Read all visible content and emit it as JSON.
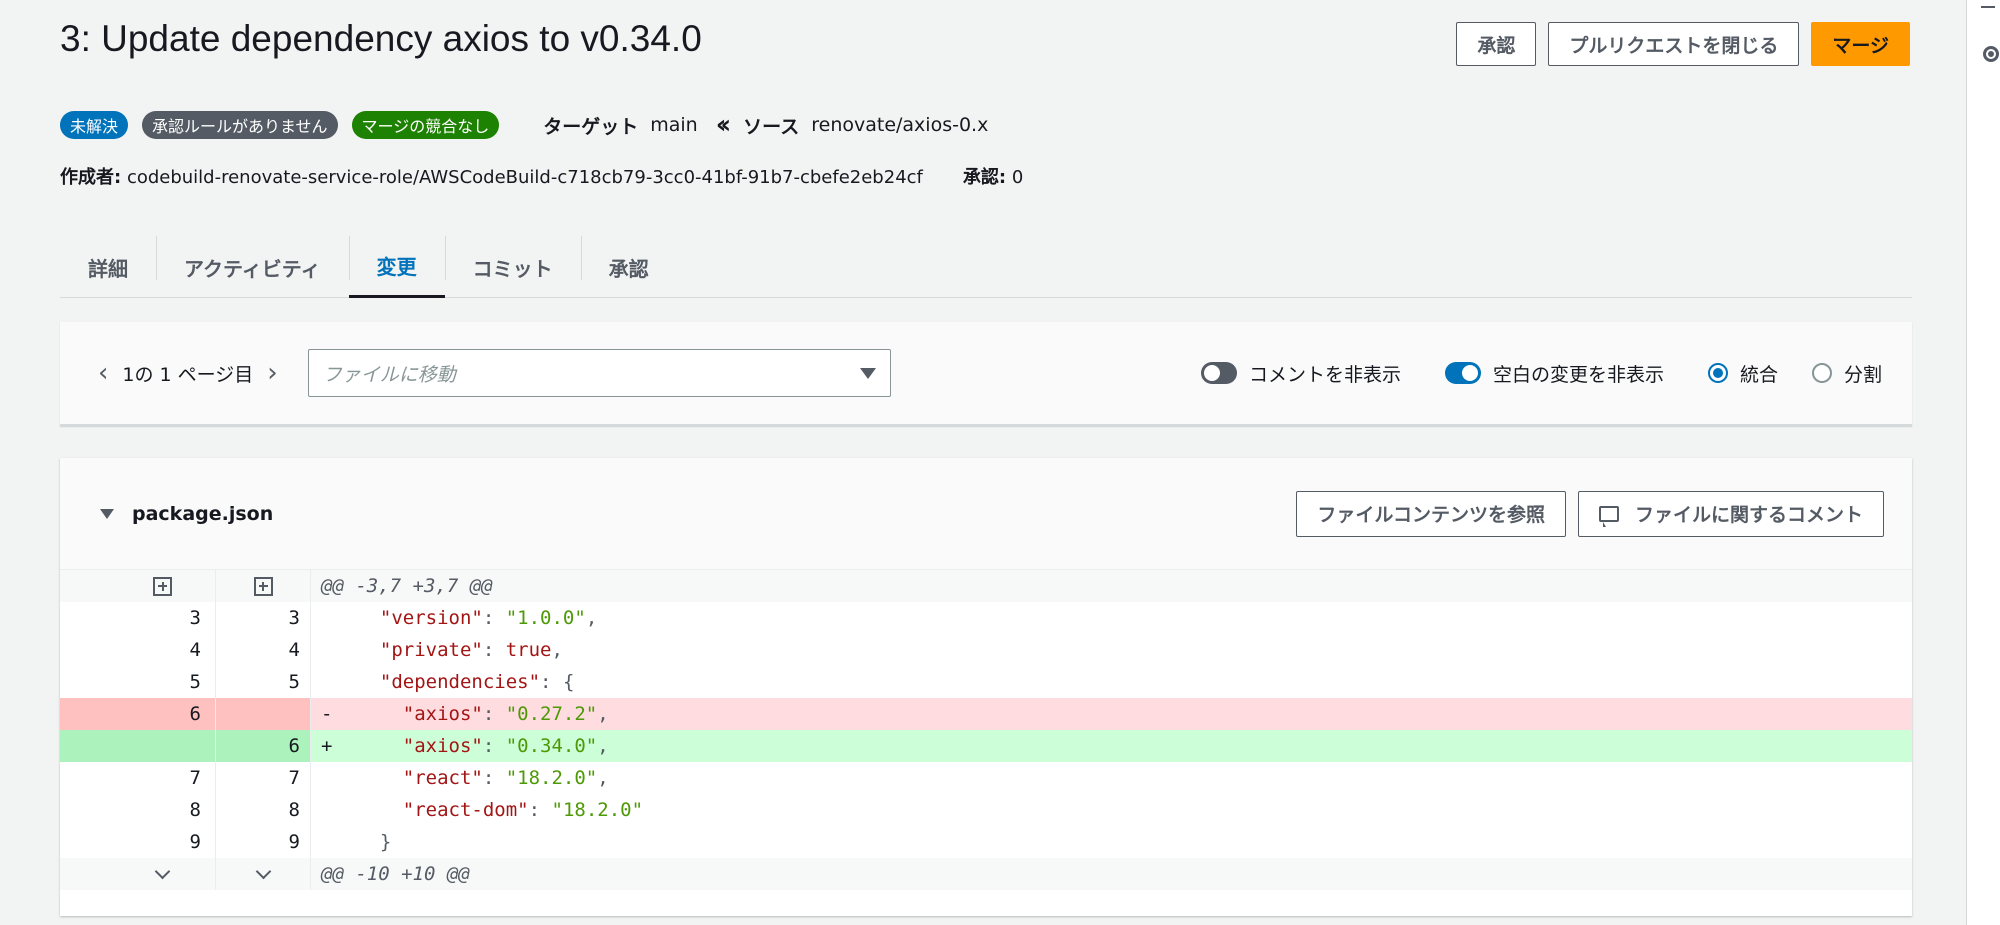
{
  "pr": {
    "title": "3: Update dependency axios to v0.34.0",
    "actions": {
      "approve": "承認",
      "close": "プルリクエストを閉じる",
      "merge": "マージ"
    },
    "badges": {
      "status": "未解決",
      "rules": "承認ルールがありません",
      "conflicts": "マージの競合なし"
    },
    "target_label": "ターゲット",
    "target_branch": "main",
    "source_label": "ソース",
    "source_branch": "renovate/axios-0.x",
    "author_label": "作成者:",
    "author": "codebuild-renovate-service-role/AWSCodeBuild-c718cb79-3cc0-41bf-91b7-cbefe2eb24cf",
    "approvals_label": "承認:",
    "approvals_count": "0"
  },
  "tabs": [
    {
      "label": "詳細",
      "active": false
    },
    {
      "label": "アクティビティ",
      "active": false
    },
    {
      "label": "変更",
      "active": true
    },
    {
      "label": "コミット",
      "active": false
    },
    {
      "label": "承認",
      "active": false
    }
  ],
  "toolbar": {
    "pager": "1の 1 ページ目",
    "file_placeholder": "ファイルに移動",
    "hide_comments": "コメントを非表示",
    "hide_whitespace": "空白の変更を非表示",
    "unified": "統合",
    "split": "分割"
  },
  "file": {
    "name": "package.json",
    "browse_button": "ファイルコンテンツを参照",
    "comment_button": "ファイルに関するコメント"
  },
  "diff": {
    "hunk_top": "@@ -3,7 +3,7 @@",
    "hunk_bottom": "@@ -10,+10 @@",
    "lines": [
      {
        "old": "3",
        "new": "3",
        "type": "ctx",
        "sign": "",
        "indent": "  ",
        "key": "\"version\"",
        "sep": ": ",
        "val": "\"1.0.0\"",
        "end": ","
      },
      {
        "old": "4",
        "new": "4",
        "type": "ctx",
        "sign": "",
        "indent": "  ",
        "key": "\"private\"",
        "sep": ": ",
        "val": "true",
        "end": ","
      },
      {
        "old": "5",
        "new": "5",
        "type": "ctx",
        "sign": "",
        "indent": "  ",
        "key": "\"dependencies\"",
        "sep": ": ",
        "val": "{",
        "end": ""
      },
      {
        "old": "6",
        "new": "",
        "type": "del",
        "sign": "-",
        "indent": "    ",
        "key": "\"axios\"",
        "sep": ": ",
        "val": "\"0.27.2\"",
        "end": ","
      },
      {
        "old": "",
        "new": "6",
        "type": "add",
        "sign": "+",
        "indent": "    ",
        "key": "\"axios\"",
        "sep": ": ",
        "val": "\"0.34.0\"",
        "end": ","
      },
      {
        "old": "7",
        "new": "7",
        "type": "ctx",
        "sign": "",
        "indent": "    ",
        "key": "\"react\"",
        "sep": ": ",
        "val": "\"18.2.0\"",
        "end": ","
      },
      {
        "old": "8",
        "new": "8",
        "type": "ctx",
        "sign": "",
        "indent": "    ",
        "key": "\"react-dom\"",
        "sep": ": ",
        "val": "\"18.2.0\"",
        "end": ""
      },
      {
        "old": "9",
        "new": "9",
        "type": "ctx",
        "sign": "",
        "indent": "  ",
        "key": "",
        "sep": "",
        "val": "}",
        "end": ""
      }
    ]
  },
  "colors": {
    "accent": "#0073bb",
    "merge": "#ff9900",
    "del_bg": "#ffdce0",
    "add_bg": "#ccffd8"
  }
}
